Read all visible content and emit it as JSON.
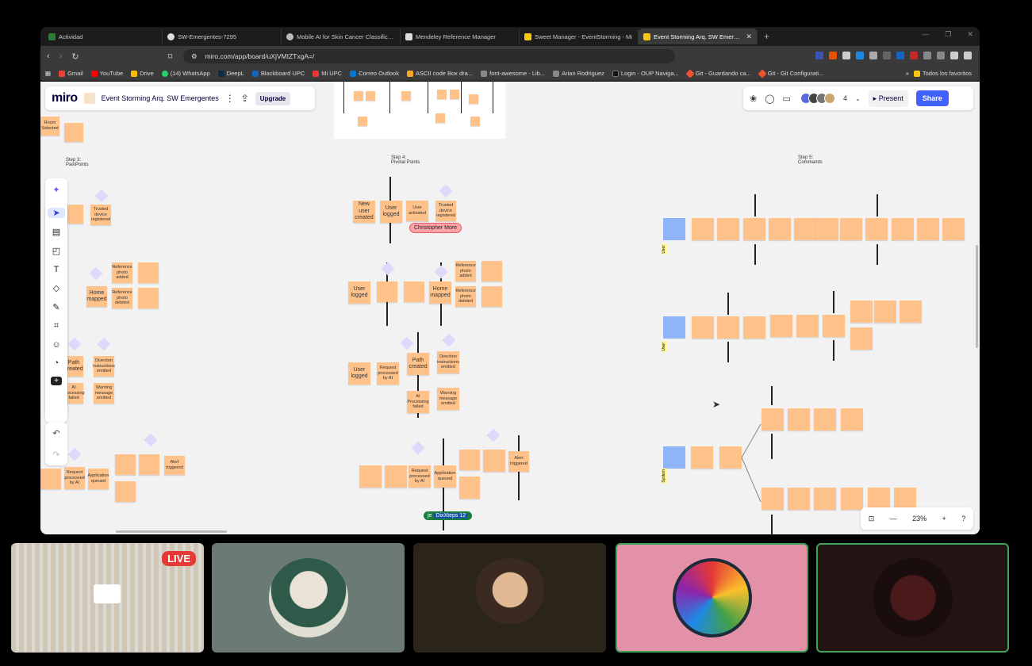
{
  "browser": {
    "tabs": [
      {
        "title": "Actividad",
        "color": "#2e7d32"
      },
      {
        "title": "SW-Emergentes-7295",
        "color": "#dddddd"
      },
      {
        "title": "Mobile AI for Skin Cancer Classificati...",
        "color": "#bbbbbb"
      },
      {
        "title": "Mendeley Reference Manager",
        "color": "#dddddd"
      },
      {
        "title": "Sweet Manager - EventStorming - Mi",
        "color": "#f9c80e"
      },
      {
        "title": "Event Storming Arq. SW Emergen",
        "color": "#f9c80e"
      }
    ],
    "url": "miro.com/app/board/uXjVMIZTxgA=/",
    "bookmarks": [
      {
        "label": "Gmail",
        "color": "#ea4335"
      },
      {
        "label": "YouTube",
        "color": "#ff0000"
      },
      {
        "label": "Drive",
        "color": "#fbbc04"
      },
      {
        "label": "(14) WhatsApp",
        "color": "#25d366"
      },
      {
        "label": "DeepL",
        "color": "#0f2b46"
      },
      {
        "label": "Blackboard UPC",
        "color": "#1565c0"
      },
      {
        "label": "Mi UPC",
        "color": "#e53935"
      },
      {
        "label": "Correo Outlook",
        "color": "#0078d4"
      },
      {
        "label": "ASCII code Box dra...",
        "color": "#f9a825"
      },
      {
        "label": "font-awesome - Lib...",
        "color": "#888888"
      },
      {
        "label": "Arian Rodriguez",
        "color": "#888888"
      },
      {
        "label": "Login - OUP Naviga...",
        "color": "#111111"
      },
      {
        "label": "Git - Guardando ca...",
        "color": "#f05133"
      },
      {
        "label": "Git - Git Configurati...",
        "color": "#f05133"
      }
    ],
    "favorites": "Todos los favoritos"
  },
  "miro": {
    "logo": "miro",
    "board_title": "Event Storming Arq. SW Emergentes",
    "upgrade": "Upgrade",
    "user_count": "4",
    "present": "Present",
    "share": "Share",
    "zoom": "23%",
    "steps": {
      "step3": "Step 3:\nPainPoints",
      "step4": "Step 4:\nPivotal Points",
      "step5": "Step 5:\nCommands"
    },
    "cursor_christopher": "Christopher More",
    "cursor_dix": "DixXteps 12",
    "cursor_dix_initials": "je",
    "lane_user": "User",
    "lane_system": "System"
  },
  "stickies": {
    "room_selected": "Room Selected",
    "new_user_created": "New user created",
    "user_logged": "User logged",
    "user_activated": "User activated",
    "trusted_device": "Trusted device registered",
    "home_mapped": "Home mapped",
    "ref_photo_added": "Reference photo added",
    "ref_photo_deleted": "Reference photo deleted",
    "path_created": "Path created",
    "ai_failed": "AI Processing failed",
    "warning_emitted": "Warning message emitted",
    "request_ai": "Request processed by AI",
    "app_queued": "Application queued",
    "alert_triggered": "Alert triggered",
    "direction_emitted": "Direction instructions emitted",
    "request_processed_ai": "Request processed by AI"
  },
  "meeting": {
    "live": "LIVE"
  }
}
